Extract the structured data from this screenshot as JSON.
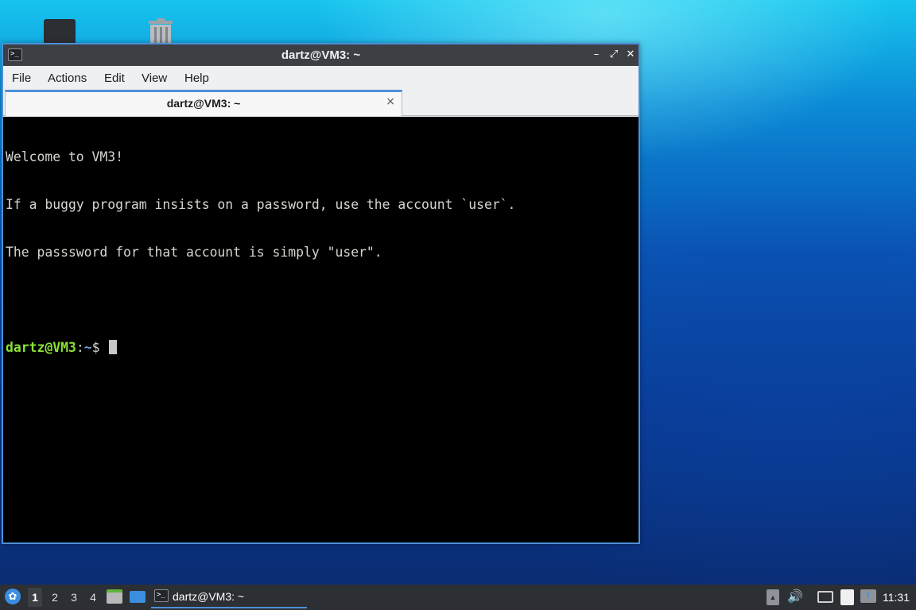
{
  "window": {
    "title": "dartz@VM3: ~",
    "min_symbol": "–",
    "max_symbol": "⤢",
    "close_symbol": "✕",
    "app_icon_glyph": ">_"
  },
  "menu": {
    "file": "File",
    "actions": "Actions",
    "edit": "Edit",
    "view": "View",
    "help": "Help"
  },
  "tab": {
    "title": "dartz@VM3: ~",
    "close_symbol": "×"
  },
  "terminal": {
    "lines": [
      "Welcome to VM3!",
      "If a buggy program insists on a password, use the account `user`.",
      "The passsword for that account is simply \"user\"."
    ],
    "prompt": {
      "user_host": "dartz@VM3",
      "colon": ":",
      "path": "~",
      "sign": "$ "
    }
  },
  "taskbar": {
    "start_glyph": "✿",
    "desktops": [
      "1",
      "2",
      "3",
      "4"
    ],
    "task_label": "dartz@VM3: ~",
    "task_icon_glyph": ">_",
    "tray_arrow": "▲",
    "volume_glyph": "🔊",
    "notify_glyph": "!",
    "clock": "11:31"
  },
  "colors": {
    "accent": "#4d90d8",
    "prompt_user": "#8ae234",
    "prompt_path": "#729fcf",
    "terminal_bg": "#000000",
    "terminal_fg": "#d3d7cf"
  }
}
